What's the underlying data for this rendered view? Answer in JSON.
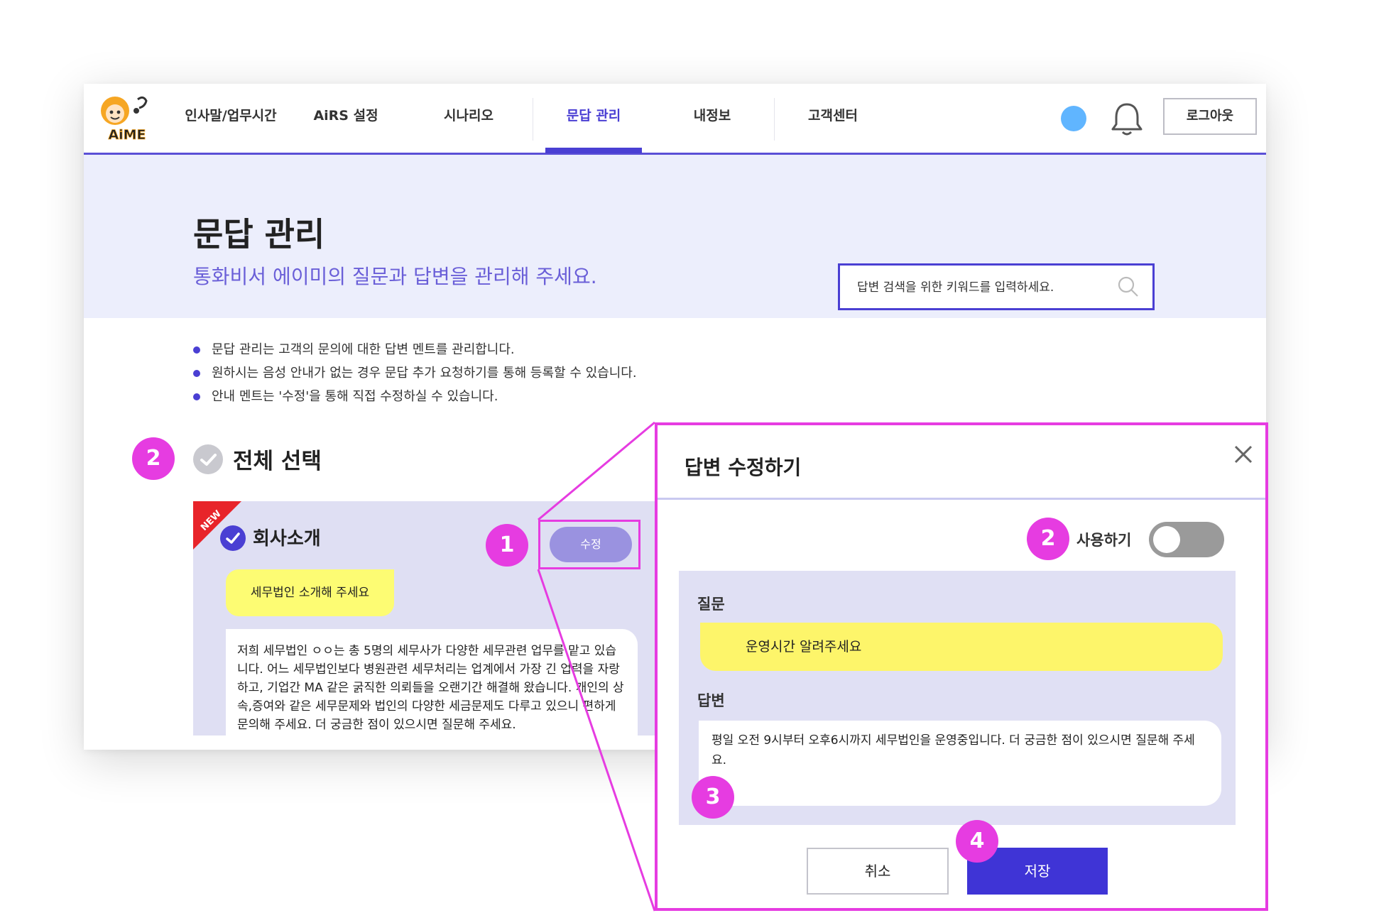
{
  "nav": {
    "items": [
      {
        "label": "인사말/업무시간"
      },
      {
        "label": "AiRS 설정"
      },
      {
        "label": "시나리오"
      },
      {
        "label": "문답 관리"
      },
      {
        "label": "내정보"
      },
      {
        "label": "고객센터"
      }
    ],
    "active_item": "문답 관리",
    "logout_label": "로그아웃",
    "logo_text": "AiME"
  },
  "hero": {
    "title": "문답 관리",
    "subtitle": "통화비서 에이미의 질문과 답변을 관리해 주세요.",
    "search_placeholder": "답변 검색을 위한 키워드를 입력하세요."
  },
  "notes": [
    "문답 관리는 고객의 문의에 대한 답변 멘트를 관리합니다.",
    "원하시는 음성 안내가 없는 경우 문답 추가 요청하기를 통해 등록할 수 있습니다.",
    "안내 멘트는 '수정'을 통해 직접 수정하실 수 있습니다."
  ],
  "select_all_label": "전체 선택",
  "card": {
    "badge": "NEW",
    "title": "회사소개",
    "edit_label": "수정",
    "question": "세무법인 소개해 주세요",
    "answer": "저희 세무법인 ㅇㅇ는 총 5명의 세무사가 다양한 세무관련 업무를 맡고 있습니다. 어느 세무법인보다 병원관련 세무처리는 업계에서 가장 긴 업력을 자랑하고, 기업간 MA 같은 굵직한 의뢰들을 오랜기간 해결해 왔습니다. 개인의 상속,증여와 같은 세무문제와 법인의 다양한 세금문제도 다루고 있으니 편하게 문의해 주세요. 더 궁금한 점이 있으시면 질문해 주세요."
  },
  "modal": {
    "title": "답변 수정하기",
    "toggle_label": "사용하기",
    "toggle_on": false,
    "question_label": "질문",
    "question": "운영시간 알려주세요",
    "answer_label": "답변",
    "answer": "평일 오전 9시부터 오후6시까지 세무법인을 운영중입니다. 더 궁금한 점이 있으시면 질문해 주세요.",
    "cancel_label": "취소",
    "save_label": "저장"
  },
  "callouts": [
    "1",
    "2",
    "2",
    "3",
    "4"
  ],
  "colors": {
    "accent": "#4a3fd3",
    "callout": "#e63ce1",
    "question_bubble": "#fdf56a",
    "hero_bg": "#eceefc",
    "status_dot": "#60b5ff"
  }
}
